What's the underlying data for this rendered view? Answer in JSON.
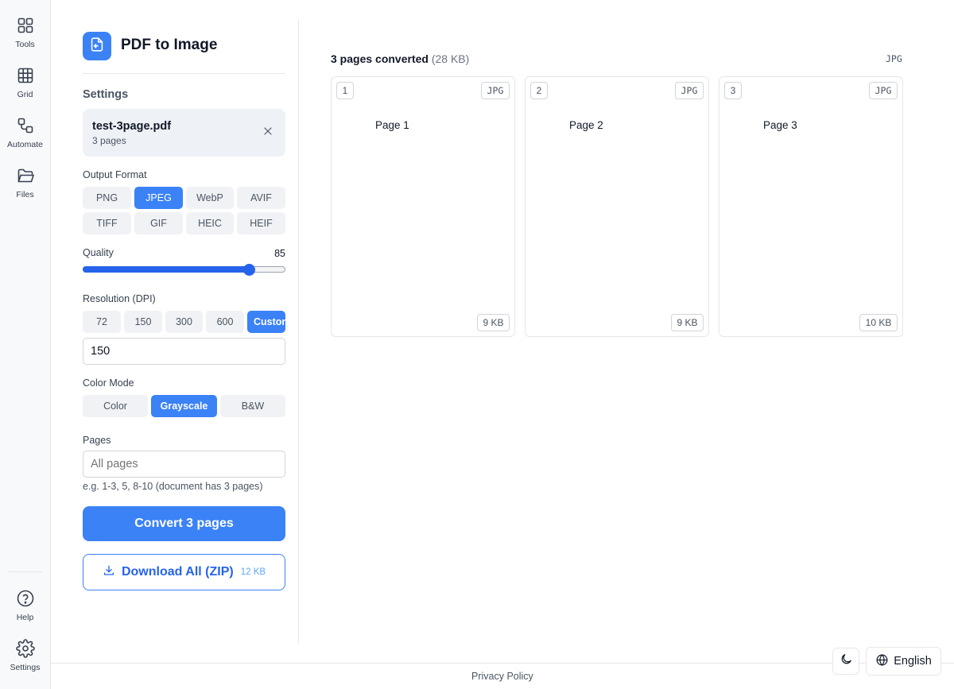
{
  "sidebar": {
    "items": [
      {
        "label": "Tools",
        "icon": "grid-2x2-icon"
      },
      {
        "label": "Grid",
        "icon": "grid-3x3-icon"
      },
      {
        "label": "Automate",
        "icon": "workflow-icon"
      },
      {
        "label": "Files",
        "icon": "folder-icon"
      }
    ],
    "bottom": [
      {
        "label": "Help",
        "icon": "help-circle-icon"
      },
      {
        "label": "Settings",
        "icon": "gear-icon"
      }
    ]
  },
  "app": {
    "title": "PDF to Image",
    "accent": "#3b82f6"
  },
  "settings": {
    "title": "Settings",
    "file": {
      "name": "test-3page.pdf",
      "pages": "3 pages"
    },
    "output_format": {
      "label": "Output Format",
      "options": [
        "PNG",
        "JPEG",
        "WebP",
        "AVIF",
        "TIFF",
        "GIF",
        "HEIC",
        "HEIF"
      ],
      "selected": "JPEG"
    },
    "quality": {
      "label": "Quality",
      "value": "85",
      "min": 0,
      "max": 100
    },
    "resolution": {
      "label": "Resolution (DPI)",
      "options": [
        "72",
        "150",
        "300",
        "600",
        "Custom"
      ],
      "selected": "Custom",
      "custom_value": "150"
    },
    "color_mode": {
      "label": "Color Mode",
      "options": [
        "Color",
        "Grayscale",
        "B&W"
      ],
      "selected": "Grayscale"
    },
    "pages": {
      "label": "Pages",
      "placeholder": "All pages",
      "value": "",
      "hint": "e.g. 1-3, 5, 8-10 (document has 3 pages)"
    },
    "convert_label": "Convert 3 pages",
    "download": {
      "label": "Download All (ZIP)",
      "size": "12 KB"
    }
  },
  "results": {
    "summary": "3 pages converted",
    "total_size": "(28 KB)",
    "format": "JPG",
    "pages": [
      {
        "number": "1",
        "format": "JPG",
        "text": "Page 1",
        "size": "9 KB"
      },
      {
        "number": "2",
        "format": "JPG",
        "text": "Page 2",
        "size": "9 KB"
      },
      {
        "number": "3",
        "format": "JPG",
        "text": "Page 3",
        "size": "10 KB"
      }
    ]
  },
  "footer": {
    "privacy": "Privacy Policy",
    "language": "English",
    "theme_icon": "moon-icon",
    "language_icon": "globe-icon"
  }
}
